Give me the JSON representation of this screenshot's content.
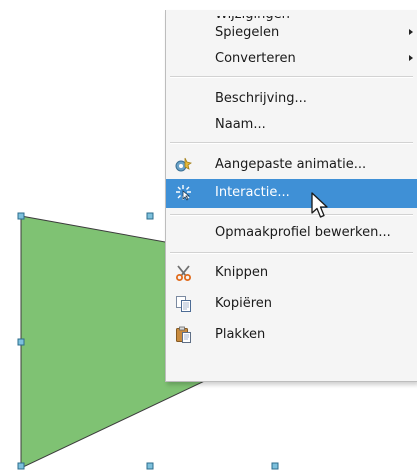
{
  "menu": {
    "top_cut": "Wijzigingen",
    "items": [
      {
        "label": "Spiegelen",
        "submenu": true
      },
      {
        "label": "Converteren",
        "submenu": true
      },
      {
        "label": "Beschrijving..."
      },
      {
        "label": "Naam..."
      },
      {
        "label": "Aangepaste animatie...",
        "icon": "custom-animation-icon"
      },
      {
        "label": "Interactie...",
        "icon": "interaction-icon",
        "highlighted": true
      },
      {
        "label": "Opmaakprofiel bewerken..."
      },
      {
        "label": "Knippen",
        "icon": "scissors-icon"
      },
      {
        "label": "Kopiëren",
        "icon": "copy-icon"
      },
      {
        "label": "Plakken",
        "icon": "paste-icon"
      }
    ]
  },
  "colors": {
    "shape_fill": "#7fc273",
    "shape_stroke": "#3c3c3c",
    "highlight": "#3f90d6",
    "menu_bg": "#f5f5f5"
  }
}
